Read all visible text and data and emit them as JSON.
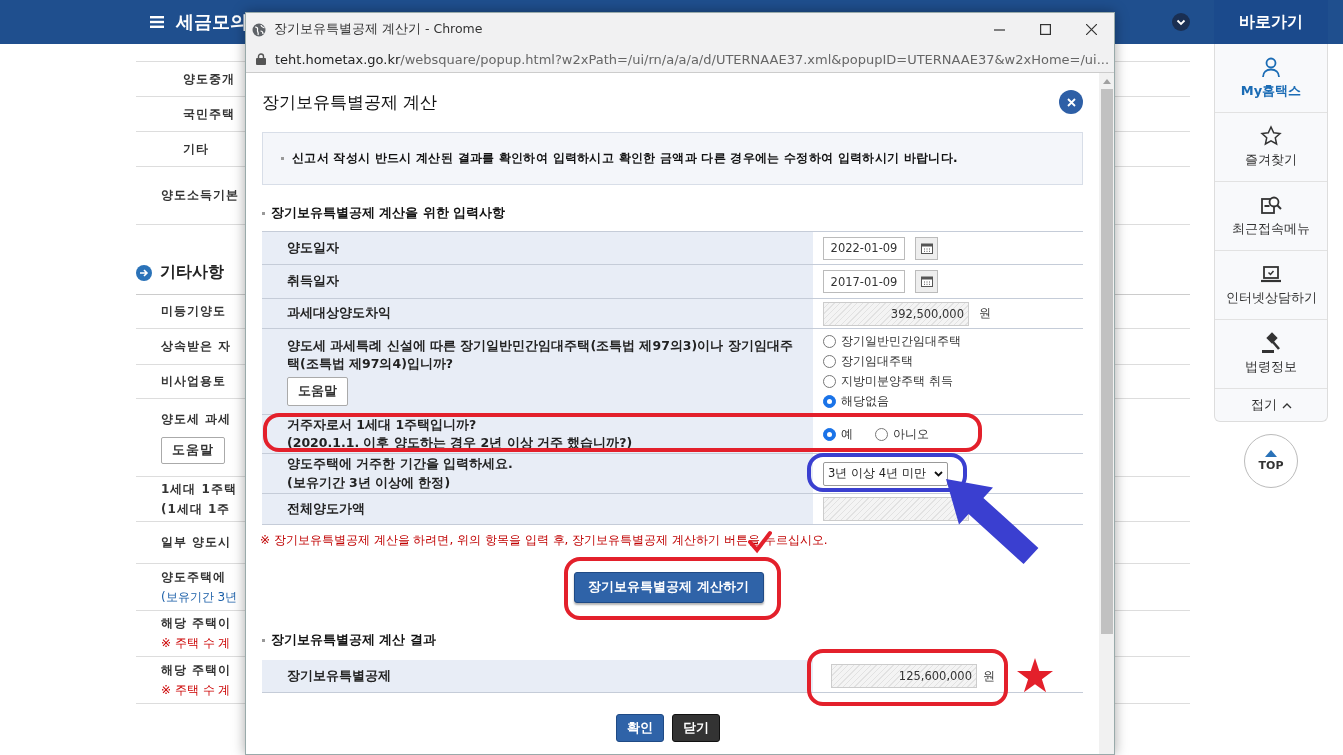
{
  "page": {
    "menu_title": "세금모의",
    "rows": [
      {
        "kind": "sub",
        "label": "양도중개"
      },
      {
        "kind": "sub",
        "label": "국민주택"
      },
      {
        "kind": "sub",
        "label": "기타"
      },
      {
        "kind": "item",
        "label": "양도소득기본"
      }
    ],
    "other_section": {
      "title": "기타사항",
      "rows": [
        {
          "lines": [
            {
              "kind": "label",
              "text": "미등기양도"
            }
          ]
        },
        {
          "lines": [
            {
              "kind": "label",
              "text": "상속받은 자"
            }
          ]
        },
        {
          "lines": [
            {
              "kind": "label",
              "text": "비사업용토"
            }
          ]
        },
        {
          "lines": [
            {
              "kind": "label",
              "text": "양도세 과세"
            }
          ],
          "button": "도움말"
        },
        {
          "lines": [
            {
              "kind": "label",
              "text": "1세대 1주택"
            },
            {
              "kind": "label",
              "text": "(1세대 1주"
            }
          ]
        },
        {
          "lines": [
            {
              "kind": "label",
              "text": "일부 양도시"
            }
          ]
        },
        {
          "lines": [
            {
              "kind": "label",
              "text": "양도주택에"
            },
            {
              "kind": "info",
              "text": "(보유기간 3년"
            }
          ]
        },
        {
          "lines": [
            {
              "kind": "label",
              "text": "해당 주택이"
            },
            {
              "kind": "warning",
              "text": "※ 주택 수 계"
            }
          ]
        },
        {
          "lines": [
            {
              "kind": "label",
              "text": "해당 주택이"
            },
            {
              "kind": "warning",
              "text": "※ 주택 수 계"
            }
          ]
        }
      ]
    }
  },
  "sidebar": {
    "title": "바로가기",
    "items": [
      {
        "label": "My홈택스",
        "active": true
      },
      {
        "label": "즐겨찾기",
        "active": false
      },
      {
        "label": "최근접속메뉴",
        "active": false
      },
      {
        "label": "인터넷상담하기",
        "active": false
      },
      {
        "label": "법령정보",
        "active": false
      }
    ],
    "collapse_label": "접기",
    "top_label": "TOP"
  },
  "popup": {
    "window_title": "장기보유특별공제 계산기 - Chrome",
    "url_host": "teht.hometax.go.kr",
    "url_path": "/websquare/popup.html?w2xPath=/ui/rn/a/a/a/d/UTERNAAE37.xml&popupID=UTERNAAE37&w2xHome=/ui...",
    "title": "장기보유특별공제 계산",
    "notice": "신고서 작성시 반드시 계산된 결과를 확인하여 입력하시고 확인한 금액과 다른 경우에는 수정하여 입력하시기 바랍니다.",
    "input_section": {
      "title": "장기보유특별공제 계산을 위한 입력사항",
      "rows": [
        {
          "kind": "date",
          "label": "양도일자",
          "value": "2022-01-09"
        },
        {
          "kind": "date",
          "label": "취득일자",
          "value": "2017-01-09"
        },
        {
          "kind": "amount",
          "label": "과세대상양도차익",
          "value": "392,500,000",
          "unit": "원"
        },
        {
          "kind": "radio-list",
          "label": "양도세 과세특례 신설에 따른 장기일반민간임대주택(조특법 제97의3)이나 장기임대주택(조특법 제97의4)입니까?",
          "help_button": "도움말",
          "options": [
            {
              "label": "장기일반민간임대주택",
              "selected": false
            },
            {
              "label": "장기임대주택",
              "selected": false
            },
            {
              "label": "지방미분양주택 취득",
              "selected": false
            },
            {
              "label": "해당없음",
              "selected": true
            }
          ]
        },
        {
          "kind": "radio-inline",
          "label": "거주자로서 1세대 1주택입니까?\n(2020.1.1. 이후 양도하는 경우 2년 이상 거주 했습니까?)",
          "red_outline": true,
          "options": [
            {
              "label": "예",
              "selected": true
            },
            {
              "label": "아니오",
              "selected": false
            }
          ]
        },
        {
          "kind": "select",
          "label": "양도주택에 거주한 기간을 입력하세요.\n(보유기간 3년 이상에 한정)",
          "value": "3년 이상 4년 미만",
          "blue_outline": true,
          "arrow_mark": true
        },
        {
          "kind": "amount",
          "label": "전체양도가액"
        }
      ]
    },
    "warning": "※ 장기보유특별공제 계산을 하려면, 위의 항목을 입력 후, 장기보유특별공제 계산하기 버튼을 누르십시오.",
    "calc_button": {
      "label": "장기보유특별공제 계산하기",
      "red_outline": true,
      "check_mark": true
    },
    "result_section": {
      "title": "장기보유특별공제 계산 결과",
      "label": "장기보유특별공제",
      "value": "125,600,000",
      "unit": "원",
      "red_outline": true,
      "star_mark": true
    },
    "buttons": [
      {
        "label": "확인",
        "kind": "primary"
      },
      {
        "label": "닫기",
        "kind": "dark"
      }
    ]
  }
}
